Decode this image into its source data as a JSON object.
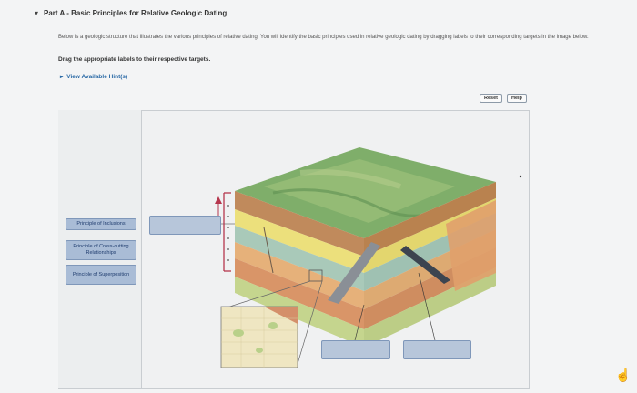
{
  "part": {
    "title": "Part A - Basic Principles for Relative Geologic Dating",
    "instructions": "Below is a geologic structure that illustrates the various principles of relative dating. You will identify the basic principles used in relative geologic dating by dragging labels to their corresponding targets in the image below.",
    "drag_instruction": "Drag the appropriate labels to their respective targets.",
    "hints_link": "View Available Hint(s)"
  },
  "toolbar": {
    "reset_label": "Reset",
    "help_label": "Help"
  },
  "labels": [
    "Principle of Inclusions",
    "Principle of Cross-cutting Relationships",
    "Principle of Superposition"
  ],
  "colors": {
    "label_fill": "#a9bcd6",
    "drop_fill": "#b7c6da",
    "link": "#2b6aa6"
  },
  "icons": {
    "collapse": "caret-down-icon",
    "hints": "caret-right-icon",
    "cursor": "hand-cursor-icon"
  }
}
